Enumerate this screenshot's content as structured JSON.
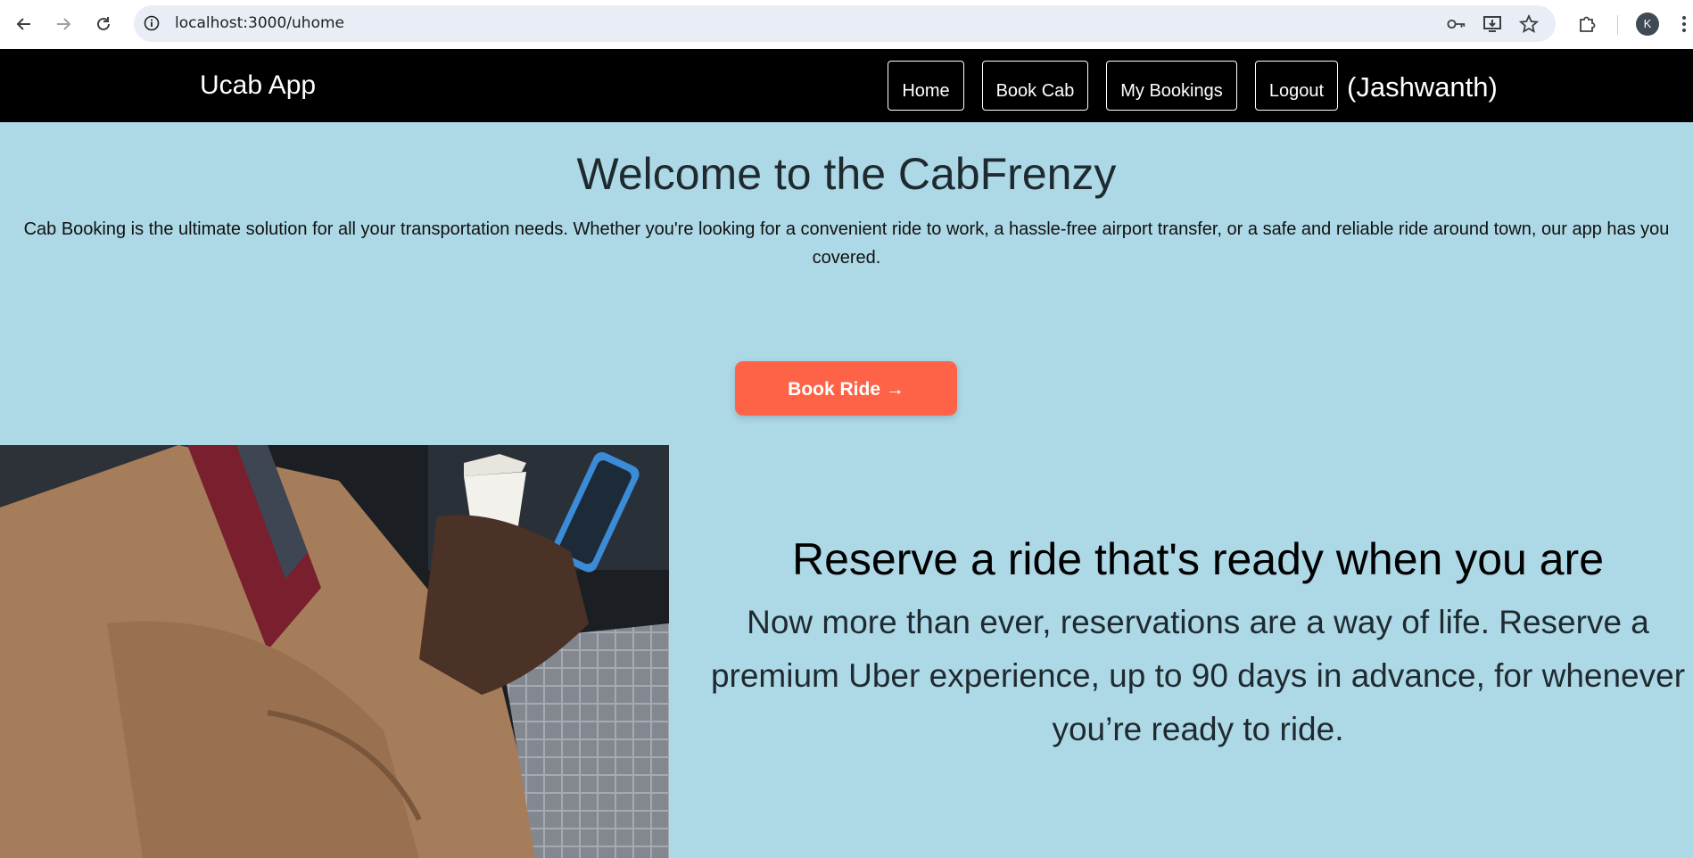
{
  "browser": {
    "url": "localhost:3000/uhome",
    "profile_initial": "K"
  },
  "navbar": {
    "brand": "Ucab App",
    "links": [
      "Home",
      "Book Cab",
      "My Bookings",
      "Logout"
    ],
    "user_label": "(Jashwanth)"
  },
  "hero": {
    "title": "Welcome to the CabFrenzy",
    "text": "Cab Booking is the ultimate solution for all your transportation needs. Whether you're looking for a convenient ride to work, a hassle-free airport transfer, or a safe and reliable ride around town, our app has you covered.",
    "cta": "Book Ride →"
  },
  "reserve": {
    "title": "Reserve a ride that's ready when you are",
    "text": "Now more than ever, reservations are a way of life. Reserve a premium Uber experience, up to 90 days in advance, for whenever you’re ready to ride."
  },
  "colors": {
    "page_bg": "#add8e6",
    "navbar_bg": "#000000",
    "cta_bg": "#ff6347"
  }
}
